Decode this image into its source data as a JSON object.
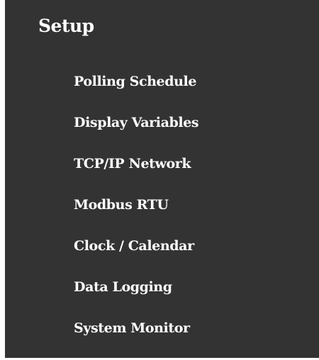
{
  "setup": {
    "title": "Setup",
    "items": [
      {
        "label": "Polling Schedule"
      },
      {
        "label": "Display Variables"
      },
      {
        "label": "TCP/IP Network"
      },
      {
        "label": "Modbus RTU"
      },
      {
        "label": "Clock / Calendar"
      },
      {
        "label": "Data Logging"
      },
      {
        "label": "System Monitor"
      }
    ]
  }
}
